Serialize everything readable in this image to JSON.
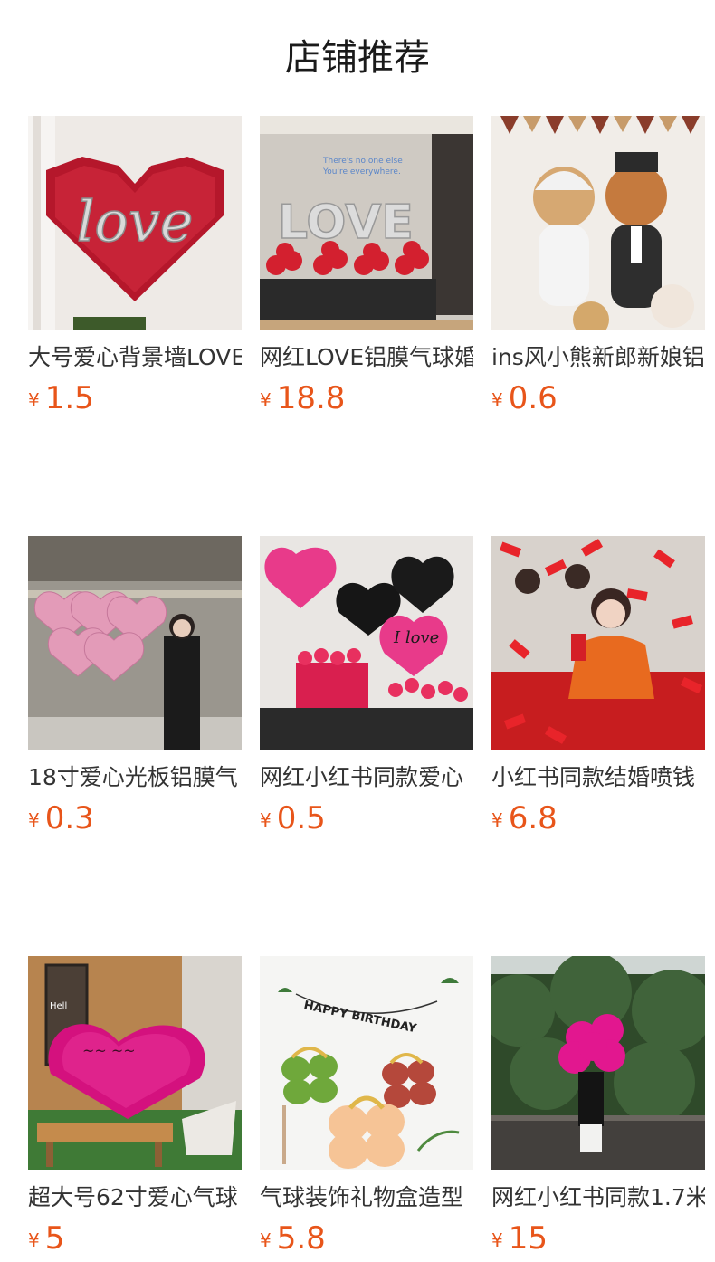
{
  "section_title": "店铺推荐",
  "products": [
    {
      "name": "大号爱心背景墙LOVE",
      "currency": "¥",
      "price": "1.5",
      "image": "red-heart-love-balloon-wall"
    },
    {
      "name": "网红LOVE铝膜气球婚",
      "currency": "¥",
      "price": "18.8",
      "image": "silver-love-letters-red-balloons"
    },
    {
      "name": "ins风小熊新郎新娘铝",
      "currency": "¥",
      "price": "0.6",
      "image": "bear-bride-groom-balloons"
    },
    {
      "name": "18寸爱心光板铝膜气",
      "currency": "¥",
      "price": "0.3",
      "image": "pink-heart-balloons-woman"
    },
    {
      "name": "网红小红书同款爱心",
      "currency": "¥",
      "price": "0.5",
      "image": "heart-balloons-rose-box"
    },
    {
      "name": "小红书同款结婚喷钱",
      "currency": "¥",
      "price": "6.8",
      "image": "red-envelope-money-spray"
    },
    {
      "name": "超大号62寸爱心气球",
      "currency": "¥",
      "price": "5",
      "image": "giant-magenta-heart-balloon"
    },
    {
      "name": "气球装饰礼物盒造型",
      "currency": "¥",
      "price": "5.8",
      "image": "gift-box-balloon-decor"
    },
    {
      "name": "网红小红书同款1.7米",
      "currency": "¥",
      "price": "15",
      "image": "giant-rose-balloon-person"
    }
  ]
}
